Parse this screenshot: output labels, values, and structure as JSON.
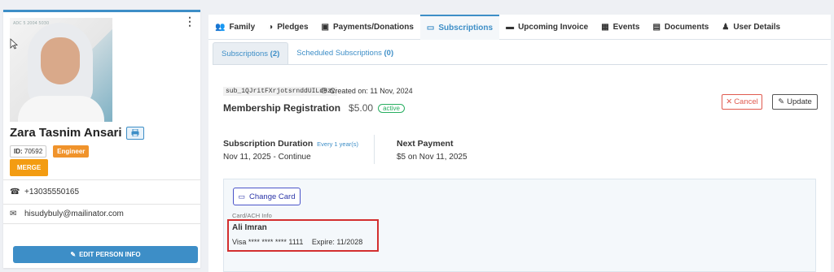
{
  "profile": {
    "watermark": "ADC 5 2004 5030",
    "name": "Zara Tasnim Ansari",
    "id_label": "ID:",
    "id_value": "70592",
    "role": "Engineer",
    "merge_label": "MERGE",
    "phone": "+13035550165",
    "email": "hisudybuly@mailinator.com",
    "edit_label": "EDIT PERSON INFO"
  },
  "tabs": [
    {
      "label": "Family",
      "icon": "users-icon"
    },
    {
      "label": "Pledges",
      "icon": "half-circle-icon"
    },
    {
      "label": "Payments/Donations",
      "icon": "money-icon"
    },
    {
      "label": "Subscriptions",
      "icon": "credit-card-icon",
      "active": true
    },
    {
      "label": "Upcoming Invoice",
      "icon": "card-icon"
    },
    {
      "label": "Events",
      "icon": "calendar-icon"
    },
    {
      "label": "Documents",
      "icon": "document-icon"
    },
    {
      "label": "User Details",
      "icon": "user-icon"
    }
  ],
  "subtabs": [
    {
      "label": "Subscriptions",
      "count": "(2)"
    },
    {
      "label": "Scheduled Subscriptions",
      "count": "(0)"
    }
  ],
  "subscription": {
    "id": "sub_1QJritFXrjotsrnddUILd8zv",
    "created": "Created on: 11 Nov, 2024",
    "title": "Membership Registration",
    "amount": "$5.00",
    "status": "active",
    "cancel_label": "Cancel",
    "update_label": "Update",
    "duration_label": "Subscription Duration",
    "duration_freq": "Every 1 year(s)",
    "duration_value": "Nov 11, 2025 - Continue",
    "next_label": "Next Payment",
    "next_value": "$5 on Nov 11, 2025"
  },
  "card": {
    "change_label": "Change Card",
    "info_label": "Card/ACH Info",
    "holder": "Ali Imran",
    "number": "Visa **** **** **** 1111",
    "expire": "Expire: 11/2028"
  },
  "colors": {
    "accent": "#3d8ec7",
    "merge": "#f39c12",
    "role": "#f0932b",
    "cancel": "#e05a4f",
    "active_status": "#27ae60",
    "highlight": "#d32f2f"
  }
}
